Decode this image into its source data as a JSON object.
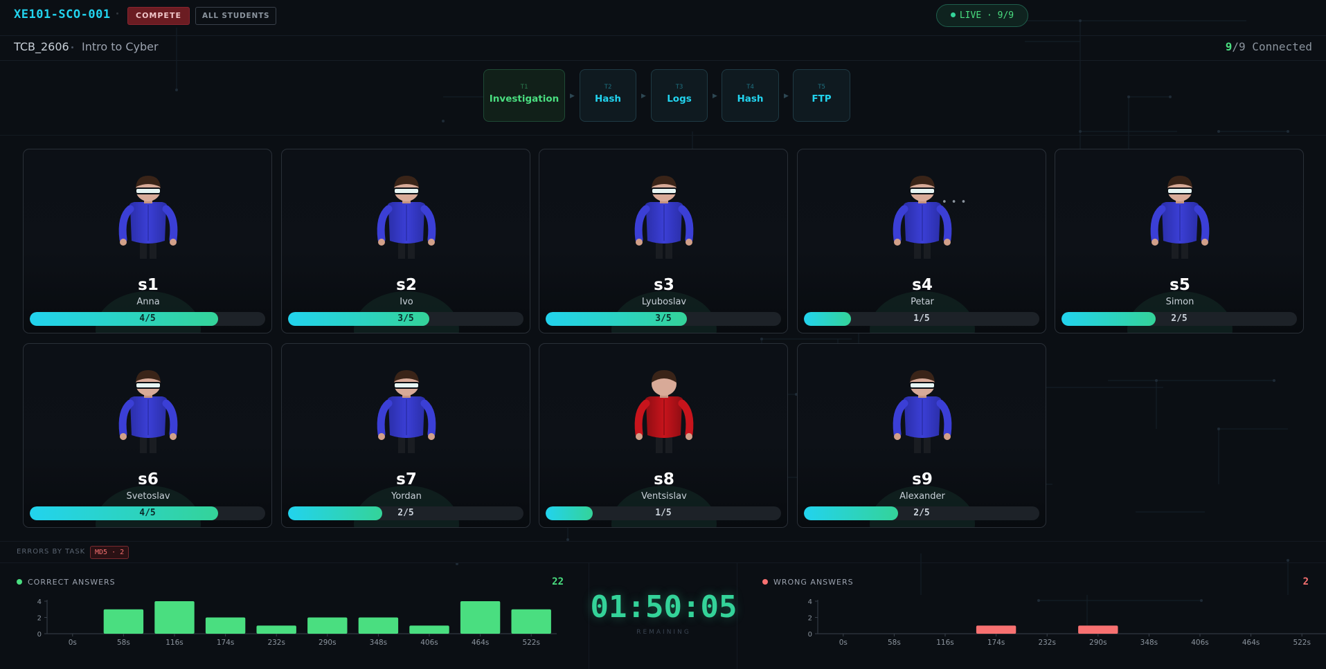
{
  "header": {
    "brand": "XE101-SCO-001",
    "compete_label": "COMPETE",
    "all_students_label": "ALL STUDENTS",
    "live_label": "LIVE · 9/9"
  },
  "course": {
    "code": "TCB_2606",
    "name": "Intro to Cyber",
    "connected_num": "9",
    "connected_rest": "/9 Connected"
  },
  "tasks": [
    {
      "id": "T1",
      "name": "Investigation",
      "active": true
    },
    {
      "id": "T2",
      "name": "Hash",
      "active": false
    },
    {
      "id": "T3",
      "name": "Logs",
      "active": false
    },
    {
      "id": "T4",
      "name": "Hash",
      "active": false
    },
    {
      "id": "T5",
      "name": "FTP",
      "active": false
    }
  ],
  "students": [
    {
      "id": "s1",
      "name": "Anna",
      "progress": "4/5",
      "fraction": 0.8,
      "shirt": "blue",
      "visor": true,
      "typing": false
    },
    {
      "id": "s2",
      "name": "Ivo",
      "progress": "3/5",
      "fraction": 0.6,
      "shirt": "blue",
      "visor": true,
      "typing": false
    },
    {
      "id": "s3",
      "name": "Lyuboslav",
      "progress": "3/5",
      "fraction": 0.6,
      "shirt": "blue",
      "visor": true,
      "typing": false
    },
    {
      "id": "s4",
      "name": "Petar",
      "progress": "1/5",
      "fraction": 0.2,
      "shirt": "blue",
      "visor": true,
      "typing": true
    },
    {
      "id": "s5",
      "name": "Simon",
      "progress": "2/5",
      "fraction": 0.4,
      "shirt": "blue",
      "visor": true,
      "typing": false
    },
    {
      "id": "s6",
      "name": "Svetoslav",
      "progress": "4/5",
      "fraction": 0.8,
      "shirt": "blue",
      "visor": true,
      "typing": false
    },
    {
      "id": "s7",
      "name": "Yordan",
      "progress": "2/5",
      "fraction": 0.4,
      "shirt": "blue",
      "visor": true,
      "typing": false
    },
    {
      "id": "s8",
      "name": "Ventsislav",
      "progress": "1/5",
      "fraction": 0.2,
      "shirt": "red",
      "visor": false,
      "typing": false
    },
    {
      "id": "s9",
      "name": "Alexander",
      "progress": "2/5",
      "fraction": 0.4,
      "shirt": "blue",
      "visor": true,
      "typing": false
    }
  ],
  "typing_indicator": "• • •",
  "errors": {
    "label": "ERRORS BY TASK",
    "badge": "MD5 · 2"
  },
  "timer": {
    "value": "01:50:05",
    "label": "REMAINING"
  },
  "correct_panel": {
    "title": "CORRECT ANSWERS",
    "count": "22"
  },
  "wrong_panel": {
    "title": "WRONG ANSWERS",
    "count": "2"
  },
  "colors": {
    "accent_cyan": "#22d3ee",
    "accent_green": "#4ade80",
    "error_red": "#f87171",
    "shirt_blue": "#3b3fd6",
    "shirt_red": "#c8141c"
  },
  "chart_data": [
    {
      "type": "bar",
      "name": "correct",
      "categories": [
        "0s",
        "58s",
        "116s",
        "174s",
        "232s",
        "290s",
        "348s",
        "406s",
        "464s",
        "522s"
      ],
      "values": [
        0,
        3,
        4,
        2,
        1,
        2,
        2,
        1,
        4,
        3
      ],
      "yticks": [
        "0",
        "2",
        "4"
      ],
      "ylim": [
        0,
        4
      ],
      "color": "#4ade80"
    },
    {
      "type": "bar",
      "name": "wrong",
      "categories": [
        "0s",
        "58s",
        "116s",
        "174s",
        "232s",
        "290s",
        "348s",
        "406s",
        "464s",
        "522s"
      ],
      "values": [
        0,
        0,
        0,
        1,
        0,
        1,
        0,
        0,
        0,
        0
      ],
      "yticks": [
        "0",
        "2",
        "4"
      ],
      "ylim": [
        0,
        4
      ],
      "color": "#f87171"
    }
  ]
}
